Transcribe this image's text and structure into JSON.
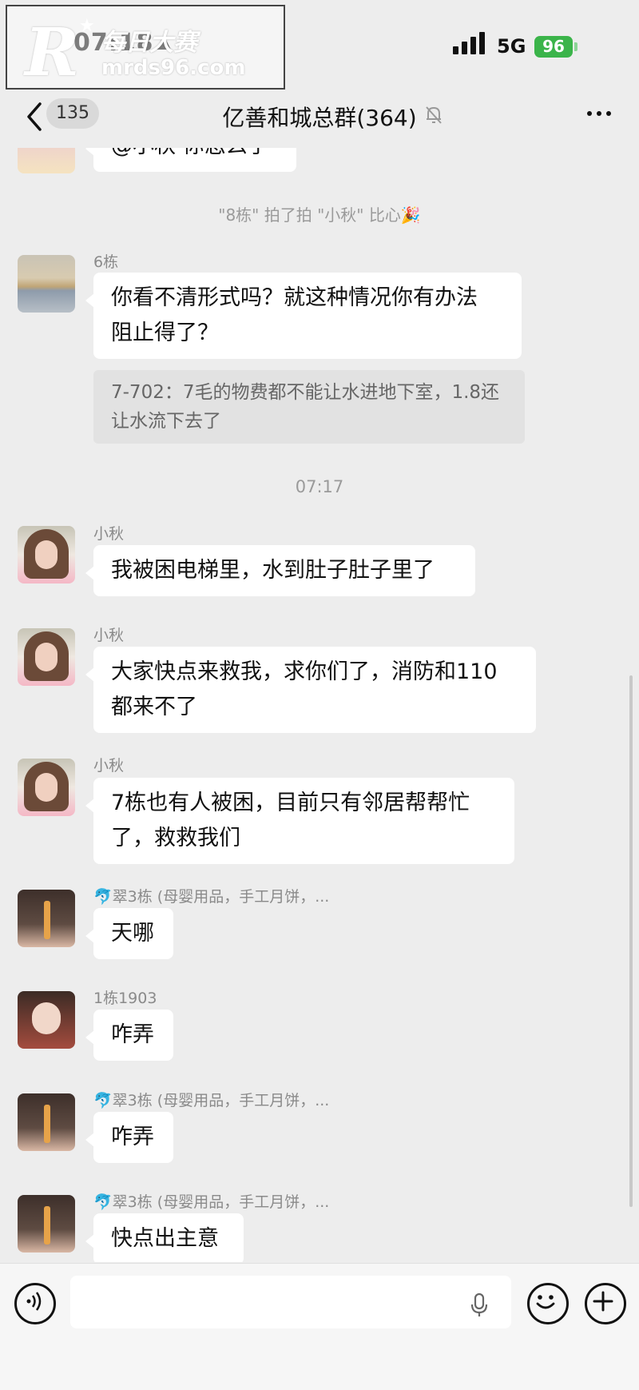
{
  "status_bar": {
    "time": "07:18",
    "network": "5G",
    "battery": "96"
  },
  "watermark": {
    "logo_letter": "R",
    "brand": "每日大赛",
    "url": "mrds96.com"
  },
  "nav": {
    "unread_count": "135",
    "title": "亿善和城总群(364)"
  },
  "messages": {
    "partial_top": {
      "text": "@小秋 你怎么了"
    },
    "system_pat": "\"8栋\" 拍了拍 \"小秋\" 比心🎉",
    "m1": {
      "sender": "6栋",
      "text_line1": "你看不清形式吗？就这种情况你有办法",
      "text_line2": "阻止得了？",
      "quote_line1": "7-702：7毛的物费都不能让水进地下室，1.8还",
      "quote_line2": "让水流下去了"
    },
    "timestamp": "07:17",
    "m2": {
      "sender": "小秋",
      "text": "我被困电梯里，水到肚子肚子里了"
    },
    "m3": {
      "sender": "小秋",
      "text_line1": "大家快点来救我，求你们了，消防和110",
      "text_line2": "都来不了"
    },
    "m4": {
      "sender": "小秋",
      "text_line1": "7栋也有人被困，目前只有邻居帮帮忙",
      "text_line2": "了，救救我们"
    },
    "m5": {
      "sender": "🐬翠3栋 (母婴用品，手工月饼，...",
      "text": "天哪"
    },
    "m6": {
      "sender": "1栋1903",
      "text": "咋弄"
    },
    "m7": {
      "sender": "🐬翠3栋 (母婴用品，手工月饼，...",
      "text": "咋弄"
    },
    "m8": {
      "sender": "🐬翠3栋 (母婴用品，手工月饼，...",
      "text": "快点出主意"
    }
  },
  "icons": [
    "back-arrow-icon",
    "mute-bell-icon",
    "more-dots-icon",
    "voice-icon",
    "microphone-icon",
    "emoji-icon",
    "plus-icon"
  ]
}
